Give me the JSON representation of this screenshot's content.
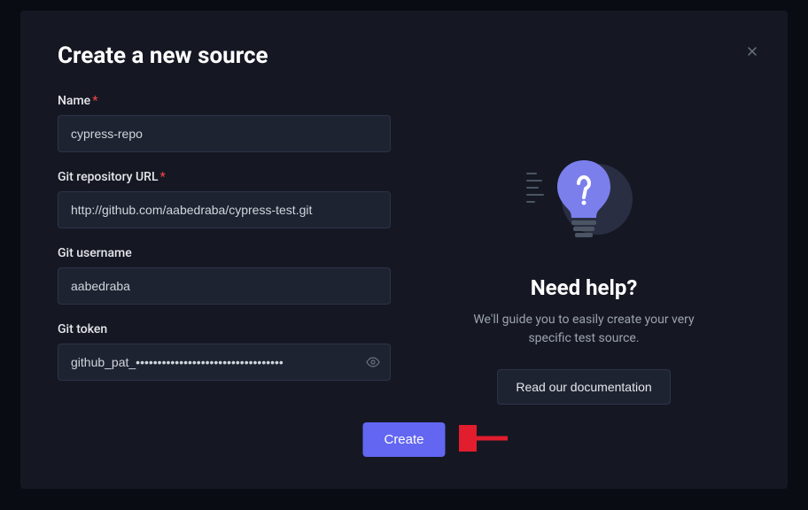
{
  "modal": {
    "title": "Create a new source",
    "form": {
      "name": {
        "label": "Name",
        "value": "cypress-repo",
        "required": true
      },
      "gitUrl": {
        "label": "Git repository URL",
        "value": "http://github.com/aabedraba/cypress-test.git",
        "required": true
      },
      "gitUsername": {
        "label": "Git username",
        "value": "aabedraba",
        "required": false
      },
      "gitToken": {
        "label": "Git token",
        "value": "github_pat_••••••••••••••••••••••••••••••••••",
        "required": false
      }
    },
    "createButton": "Create"
  },
  "help": {
    "title": "Need help?",
    "description": "We'll guide you to easily create your very specific test source.",
    "docsButton": "Read our documentation"
  }
}
